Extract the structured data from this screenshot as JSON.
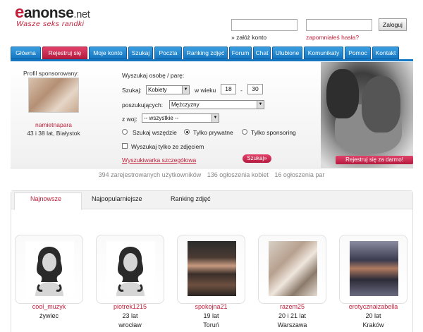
{
  "header": {
    "logo_e": "e",
    "logo_name": "anonse",
    "logo_tld": ".net",
    "tagline": "Wasze seks randki",
    "login_button": "Zaloguj",
    "register_link": "» załóż konto",
    "forgot_link": "zapomniałeś hasła?"
  },
  "nav": {
    "tabs": [
      {
        "label": "Główna"
      },
      {
        "label": "Rejestruj się"
      },
      {
        "label": "Moje konto"
      },
      {
        "label": "Szukaj"
      },
      {
        "label": "Poczta"
      },
      {
        "label": "Ranking zdjęć"
      },
      {
        "label": "Forum"
      },
      {
        "label": "Chat"
      },
      {
        "label": "Ulubione"
      },
      {
        "label": "Komunikaty"
      },
      {
        "label": "Pomoc"
      },
      {
        "label": "Kontakt"
      }
    ],
    "active_index": 1
  },
  "sponsor": {
    "title": "Profil sponsorowany:",
    "name": "namietnapara",
    "info": "43 i 38 lat, Białystok"
  },
  "search": {
    "heading": "Wyszukaj osobę / parę:",
    "szukaj_label": "Szukaj:",
    "szukaj_value": "Kobiety",
    "age_label": "w wieku",
    "age_from": "18",
    "age_sep": "-",
    "age_to": "30",
    "looking_label": "poszukujących:",
    "looking_value": "Mężczyzny",
    "region_label": "z woj:",
    "region_value": "-- wszystkie --",
    "radio_all": "Szukaj wszędzie",
    "radio_private": "Tylko prywatne",
    "radio_sponsor": "Tylko sponsoring",
    "checkbox_photo": "Wyszukaj tylko ze zdjęciem",
    "advanced_link": "Wyszukiwarka szczegółowa",
    "search_button": "Szukaj»"
  },
  "hero": {
    "register_button": "Rejestruj się za darmo!"
  },
  "stats": {
    "users": "394 zarejestrowanych użytkowników",
    "women": "136 ogłoszenia kobiet",
    "couples": "16 ogłoszenia par"
  },
  "sections": {
    "tabs": [
      "Najnowsze",
      "Najpopularniejsze",
      "Ranking zdjęć"
    ]
  },
  "profiles": [
    {
      "name": "cool_muzyk",
      "age": "",
      "city": "żywiec",
      "photo": "silhouette-icon"
    },
    {
      "name": "piotrek1215",
      "age": "23 lat",
      "city": "wrocław",
      "photo": "silhouette-icon"
    },
    {
      "name": "spokojna21",
      "age": "19 lat",
      "city": "Toruń",
      "photo": "photo"
    },
    {
      "name": "razem25",
      "age": "20 i 21 lat",
      "city": "Warszawa",
      "photo": "photo"
    },
    {
      "name": "erotycznaizabella",
      "age": "20 lat",
      "city": "Kraków",
      "photo": "photo"
    }
  ],
  "colors": {
    "brand_red": "#c2203a",
    "nav_blue": "#1576c2",
    "nav_active": "#b51b3f"
  }
}
